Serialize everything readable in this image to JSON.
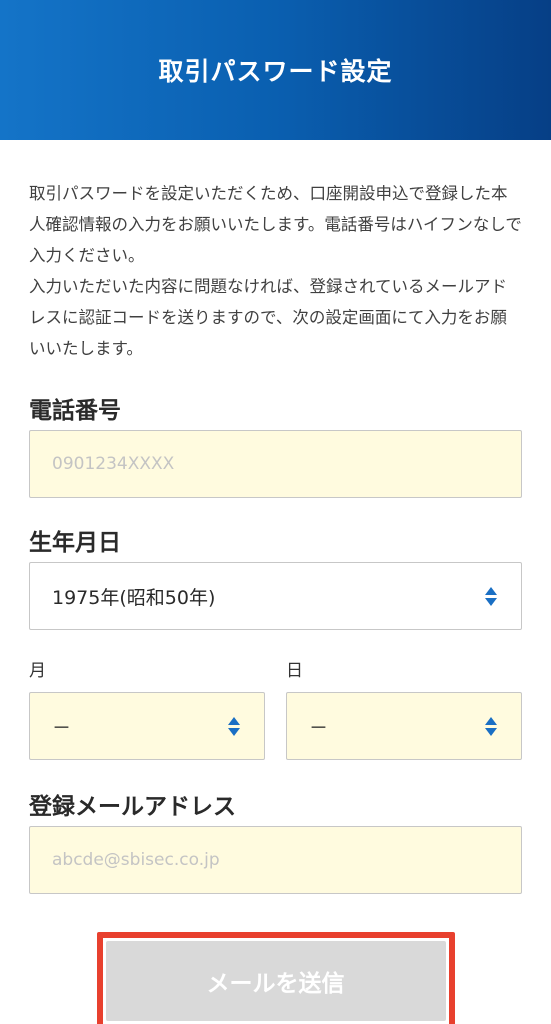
{
  "header": {
    "title": "取引パスワード設定"
  },
  "intro": {
    "line1": "取引パスワードを設定いただくため、口座開設申込で登録した本人確認情報の入力をお願いいたします。電話番号はハイフンなしで入力ください。",
    "line2": "入力いただいた内容に問題なければ、登録されているメールアドレスに認証コードを送りますので、次の設定画面にて入力をお願いいたします。"
  },
  "phone": {
    "label": "電話番号",
    "placeholder": "0901234XXXX"
  },
  "birth": {
    "label": "生年月日",
    "year_value": "1975年(昭和50年)",
    "month_label": "月",
    "month_value": "－",
    "day_label": "日",
    "day_value": "－"
  },
  "email": {
    "label": "登録メールアドレス",
    "placeholder": "abcde@sbisec.co.jp"
  },
  "submit": {
    "label": "メールを送信"
  },
  "colors": {
    "accent": "#1a6fc4",
    "highlight": "#e8402e",
    "field_bg": "#fffbdf"
  }
}
